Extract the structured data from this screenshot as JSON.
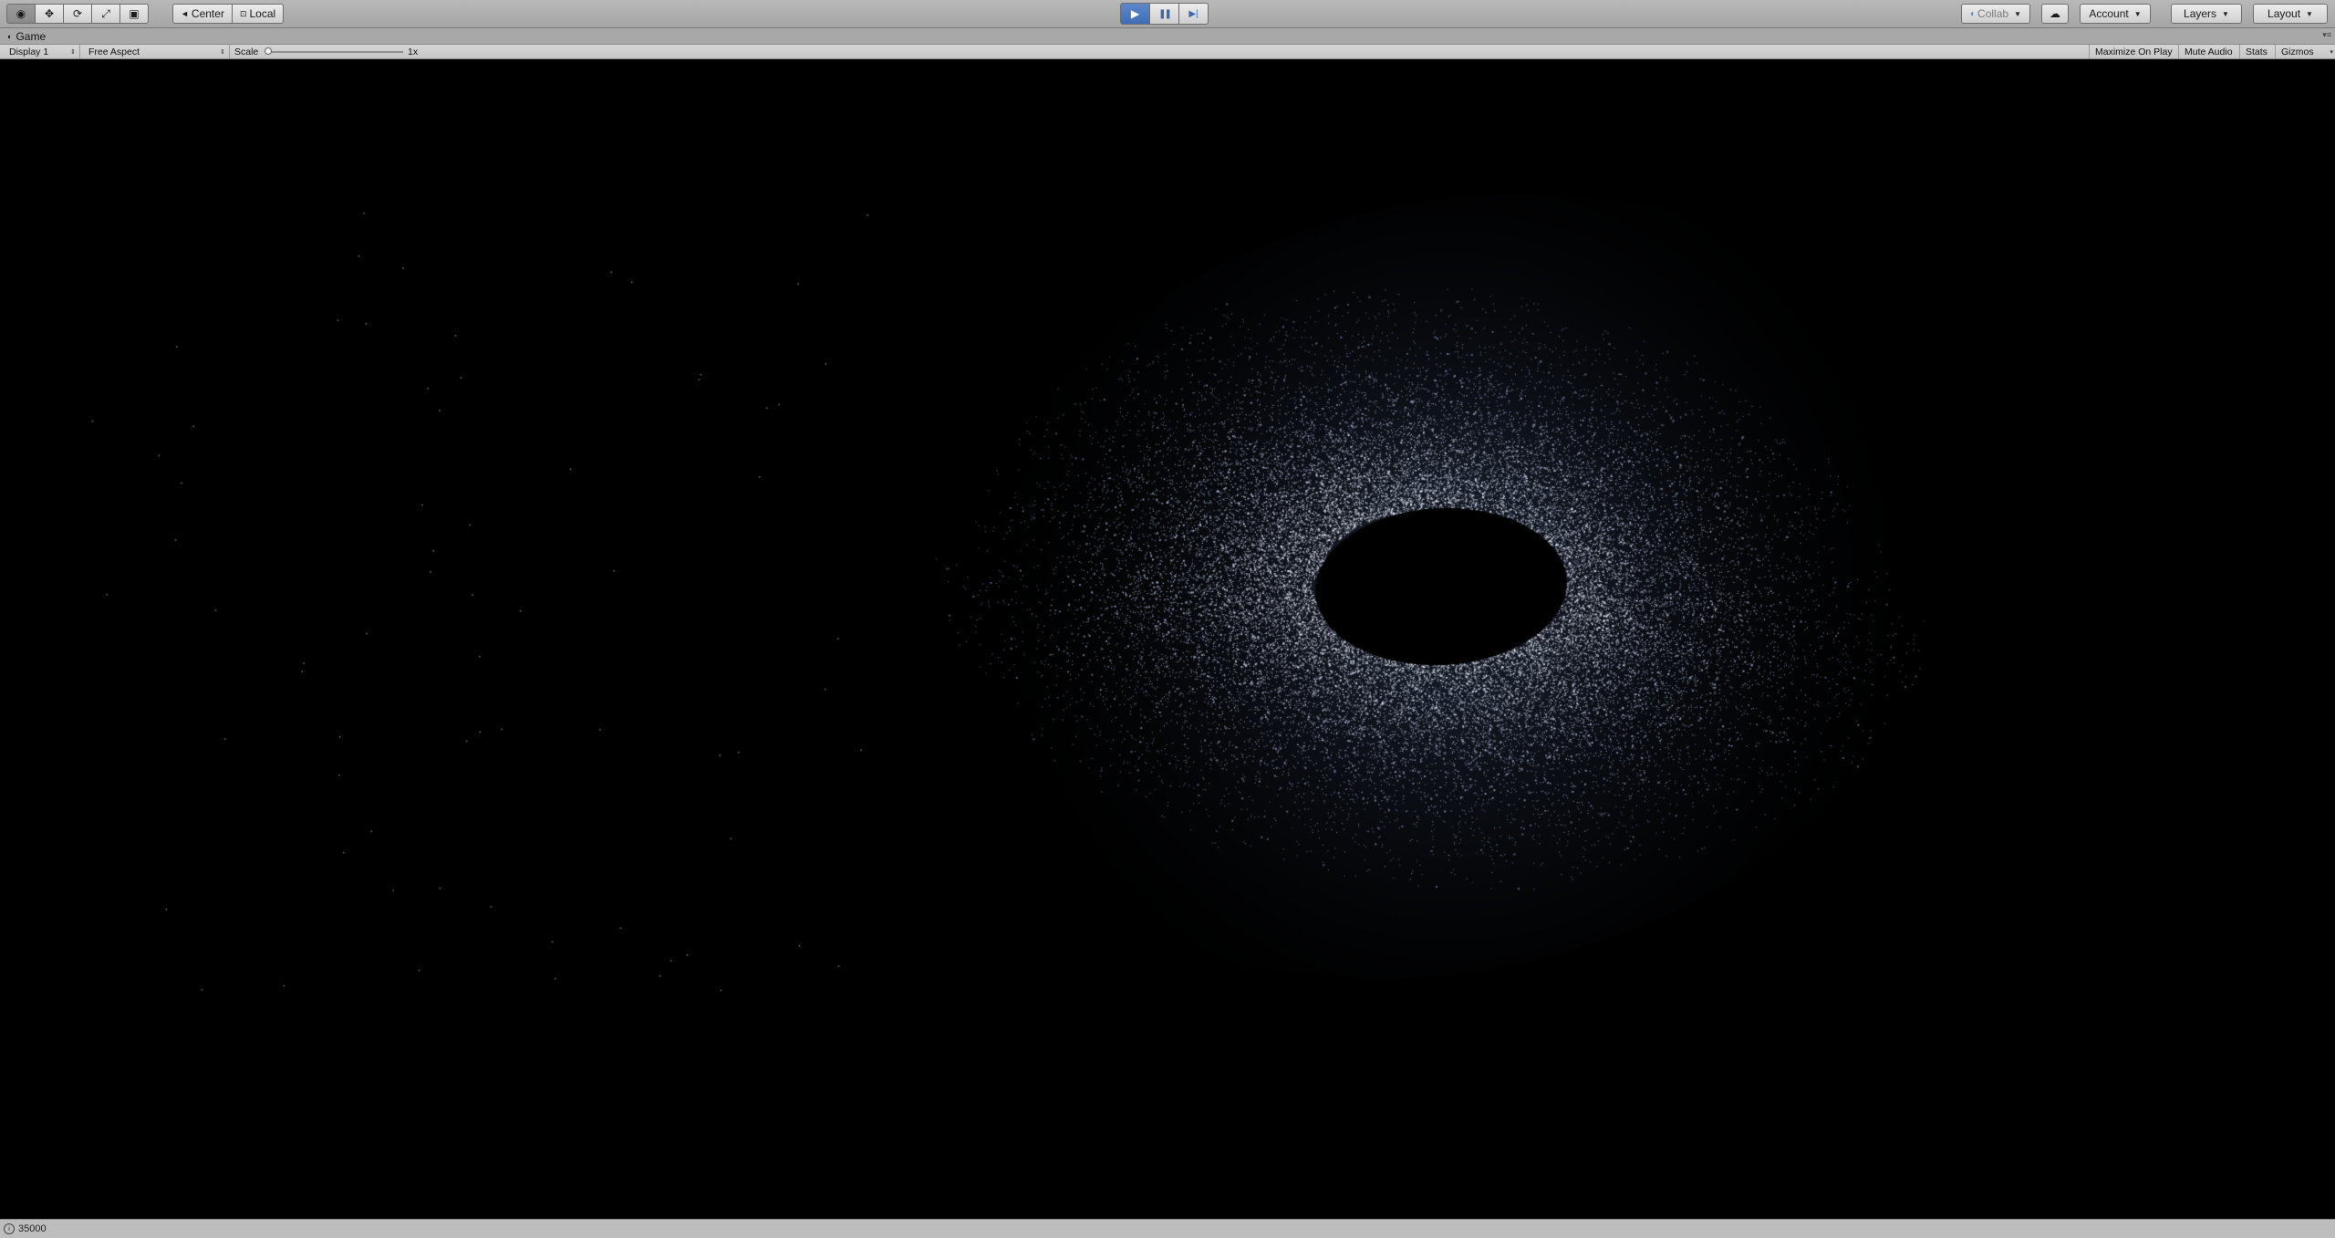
{
  "toolbar": {
    "tools": [
      {
        "icon": "eye-icon",
        "glyph": "◉"
      },
      {
        "icon": "move-icon",
        "glyph": "✥"
      },
      {
        "icon": "rotate-icon",
        "glyph": "⟳"
      },
      {
        "icon": "scale-icon",
        "glyph": "⤢"
      },
      {
        "icon": "rect-icon",
        "glyph": "▣"
      }
    ],
    "pivot_label": "Center",
    "space_label": "Local",
    "play_glyph": "▶",
    "pause_glyph": "❚❚",
    "step_glyph": "▶|",
    "collab_label": "Collab",
    "account_label": "Account",
    "layers_label": "Layers",
    "layout_label": "Layout",
    "cloud_glyph": "☁",
    "accent_color": "#4a78c2"
  },
  "tab": {
    "title": "Game"
  },
  "gamebar": {
    "display_label": "Display 1",
    "aspect_label": "Free Aspect",
    "scale_label": "Scale",
    "scale_value": "1x",
    "maximize_label": "Maximize On Play",
    "mute_label": "Mute Audio",
    "stats_label": "Stats",
    "gizmos_label": "Gizmos"
  },
  "status": {
    "text": "35000"
  }
}
